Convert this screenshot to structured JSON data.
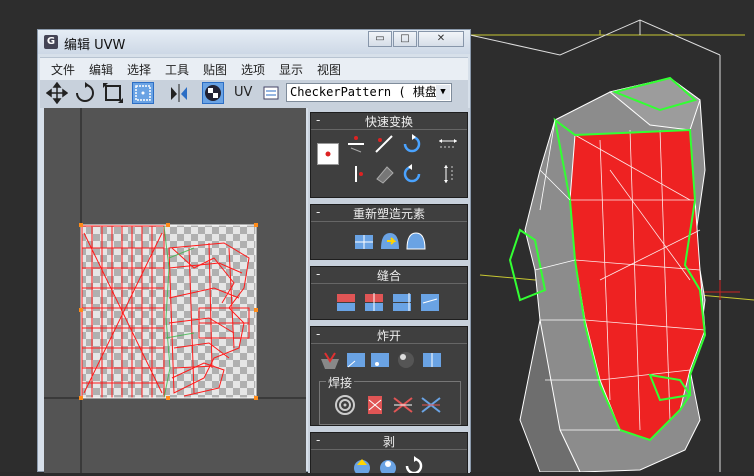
{
  "window": {
    "title": "编辑 UVW",
    "min_glyph": "▭",
    "max_glyph": "□",
    "close_glyph": "✕"
  },
  "menu": [
    "文件",
    "编辑",
    "选择",
    "工具",
    "贴图",
    "选项",
    "显示",
    "视图"
  ],
  "toolbar": {
    "uv_label": "UV",
    "map_dropdown": "CheckerPattern  ( 棋盘格 )",
    "dropdown_arrow": "▼"
  },
  "panel": {
    "quick_transform": "快速变换",
    "reshape": "重新塑造元素",
    "stitch": "缝合",
    "explode": "炸开",
    "weld": "焊接",
    "peel": "剥",
    "collapse_glyph": "-"
  },
  "colors": {
    "uv_edges": "#ff1a1a",
    "selection": "#33ff33",
    "accent": "#2c6ec5"
  }
}
